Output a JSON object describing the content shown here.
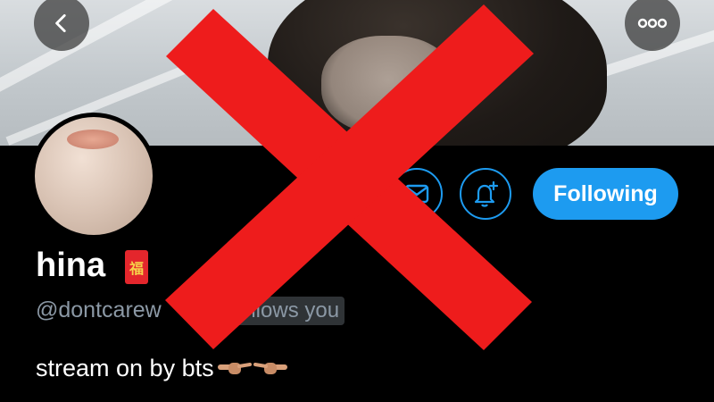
{
  "header": {
    "back_icon": "chevron-left-icon",
    "more_icon": "more-horizontal-icon"
  },
  "profile": {
    "display_name": "hina",
    "name_badge_icon": "red-envelope-emoji",
    "name_badge_glyph": "福",
    "handle": "@dontcarew",
    "follows_you": "ollows you",
    "bio": "stream on by bts",
    "bio_emoji": [
      "backhand-index-pointing-right-icon",
      "backhand-index-pointing-left-icon"
    ]
  },
  "actions": {
    "message_icon": "mail-icon",
    "notify_icon": "bell-plus-icon",
    "following_label": "Following"
  },
  "overlay": {
    "icon": "red-cross-icon"
  },
  "colors": {
    "accent": "#1d9bf0",
    "background": "#000000",
    "muted_text": "#8b98a5",
    "cross": "#ee1c1c"
  }
}
